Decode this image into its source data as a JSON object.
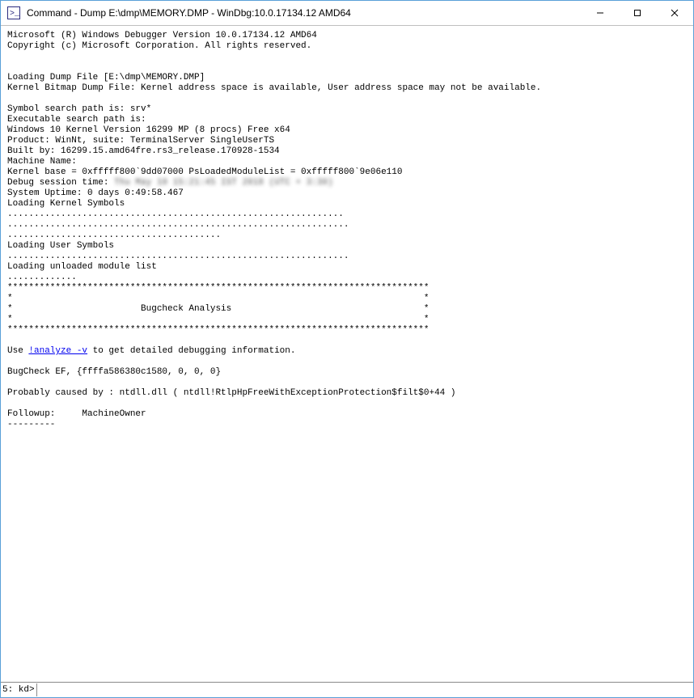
{
  "window": {
    "title": "Command - Dump E:\\dmp\\MEMORY.DMP - WinDbg:10.0.17134.12 AMD64"
  },
  "output": {
    "line1": "Microsoft (R) Windows Debugger Version 10.0.17134.12 AMD64",
    "line2": "Copyright (c) Microsoft Corporation. All rights reserved.",
    "blank1": "",
    "blank2": "",
    "line3": "Loading Dump File [E:\\dmp\\MEMORY.DMP]",
    "line4": "Kernel Bitmap Dump File: Kernel address space is available, User address space may not be available.",
    "blank3": "",
    "line5": "Symbol search path is: srv*",
    "line6": "Executable search path is: ",
    "line7": "Windows 10 Kernel Version 16299 MP (8 procs) Free x64",
    "line8": "Product: WinNt, suite: TerminalServer SingleUserTS",
    "line9": "Built by: 16299.15.amd64fre.rs3_release.170928-1534",
    "line10": "Machine Name:",
    "line11": "Kernel base = 0xfffff800`9dd07000 PsLoadedModuleList = 0xfffff800`9e06e110",
    "line12a": "Debug session time: ",
    "line12b": "Thu May 10 15:21:45 IST 2018 (UTC + 3:30)",
    "line13": "System Uptime: 0 days 0:49:58.467",
    "line14": "Loading Kernel Symbols",
    "dots1": "...............................................................",
    "dots2": "................................................................",
    "dots3": "........................................",
    "line15": "Loading User Symbols",
    "dots4": "................................................................",
    "line16": "Loading unloaded module list",
    "dots5": ".............",
    "stars_top": "*******************************************************************************",
    "stars_side1": "*                                                                             *",
    "stars_mid": "*                        Bugcheck Analysis                                    *",
    "stars_side2": "*                                                                             *",
    "stars_bot": "*******************************************************************************",
    "blank4": "",
    "use_pre": "Use ",
    "analyze_link": "!analyze -v",
    "use_post": " to get detailed debugging information.",
    "blank5": "",
    "bugcheck": "BugCheck EF, {ffffa586380c1580, 0, 0, 0}",
    "blank6": "",
    "probably": "Probably caused by : ntdll.dll ( ntdll!RtlpHpFreeWithExceptionProtection$filt$0+44 )",
    "blank7": "",
    "followup": "Followup:     MachineOwner",
    "dashes": "---------"
  },
  "prompt": {
    "label": "5: kd>",
    "value": ""
  }
}
